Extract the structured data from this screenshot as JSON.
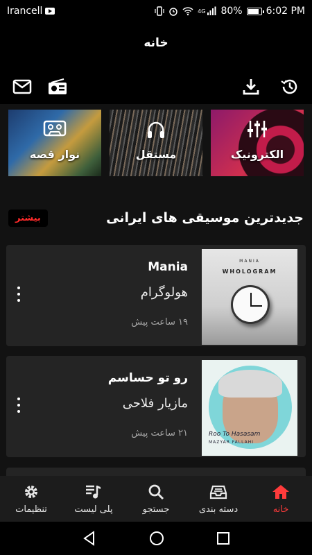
{
  "status_bar": {
    "carrier": "Irancell",
    "battery": "80%",
    "time": "6:02 PM",
    "network": "4G"
  },
  "header": {
    "title": "خانه"
  },
  "categories": [
    {
      "label": "الکترونیک",
      "icon": "equalizer-icon"
    },
    {
      "label": "مستقل",
      "icon": "headphones-icon"
    },
    {
      "label": "نوار قصه",
      "icon": "cassette-icon"
    }
  ],
  "section": {
    "title": "جدیدترین موسیقی های ایرانی",
    "more_label": "بیشتر"
  },
  "tracks": [
    {
      "song": "Mania",
      "artist": "هولوگرام",
      "time": "۱۹ ساعت پیش",
      "cover_text_1": "MANIA",
      "cover_text_2": "WHOLOGRAM"
    },
    {
      "song": "رو تو حساسم",
      "artist": "مازیار فلاحی",
      "time": "۲۱ ساعت پیش",
      "cover_text_1": "Roo To Hasasam",
      "cover_text_2": "MAZYAR FALLAHI"
    }
  ],
  "bottom_nav": [
    {
      "label": "خانه",
      "icon": "home-icon",
      "active": true
    },
    {
      "label": "دسته بندی",
      "icon": "inbox-tray-icon",
      "active": false
    },
    {
      "label": "جستجو",
      "icon": "search-icon",
      "active": false
    },
    {
      "label": "پلی لیست",
      "icon": "playlist-icon",
      "active": false
    },
    {
      "label": "تنظیمات",
      "icon": "settings-icon",
      "active": false
    }
  ],
  "colors": {
    "accent": "#ff3b3b",
    "background": "#121212",
    "card": "#242424"
  }
}
